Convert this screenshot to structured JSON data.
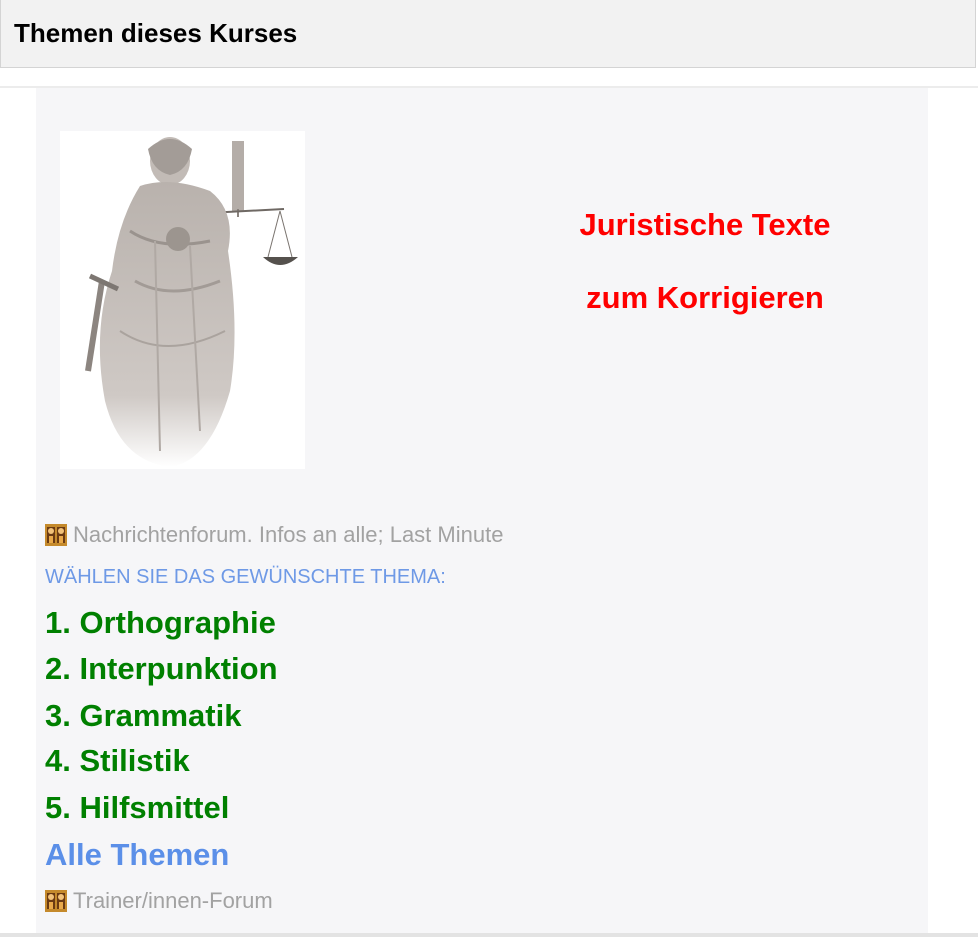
{
  "header": {
    "title": "Themen dieses Kurses"
  },
  "course": {
    "title_line1": "Juristische Texte",
    "title_line2": "zum Korrigieren"
  },
  "forums": {
    "news": "Nachrichtenforum. Infos an alle; Last Minute",
    "trainer": "Trainer/innen-Forum"
  },
  "instruction": "WÄHLEN SIE DAS GEWÜNSCHTE THEMA:",
  "topics": [
    "1. Orthographie",
    "2. Interpunktion",
    "3. Grammatik",
    "4. Stilistik",
    "5. Hilfsmittel"
  ],
  "all_topics": "Alle Themen",
  "colors": {
    "title_red": "#ff0000",
    "topic_green": "#008000",
    "link_blue": "#5b8fe8",
    "instruction_blue": "#6e99e6",
    "muted_gray": "#a2a2a2"
  },
  "icons": {
    "forum": "forum-people-icon",
    "image": "justitia-statue-image"
  }
}
